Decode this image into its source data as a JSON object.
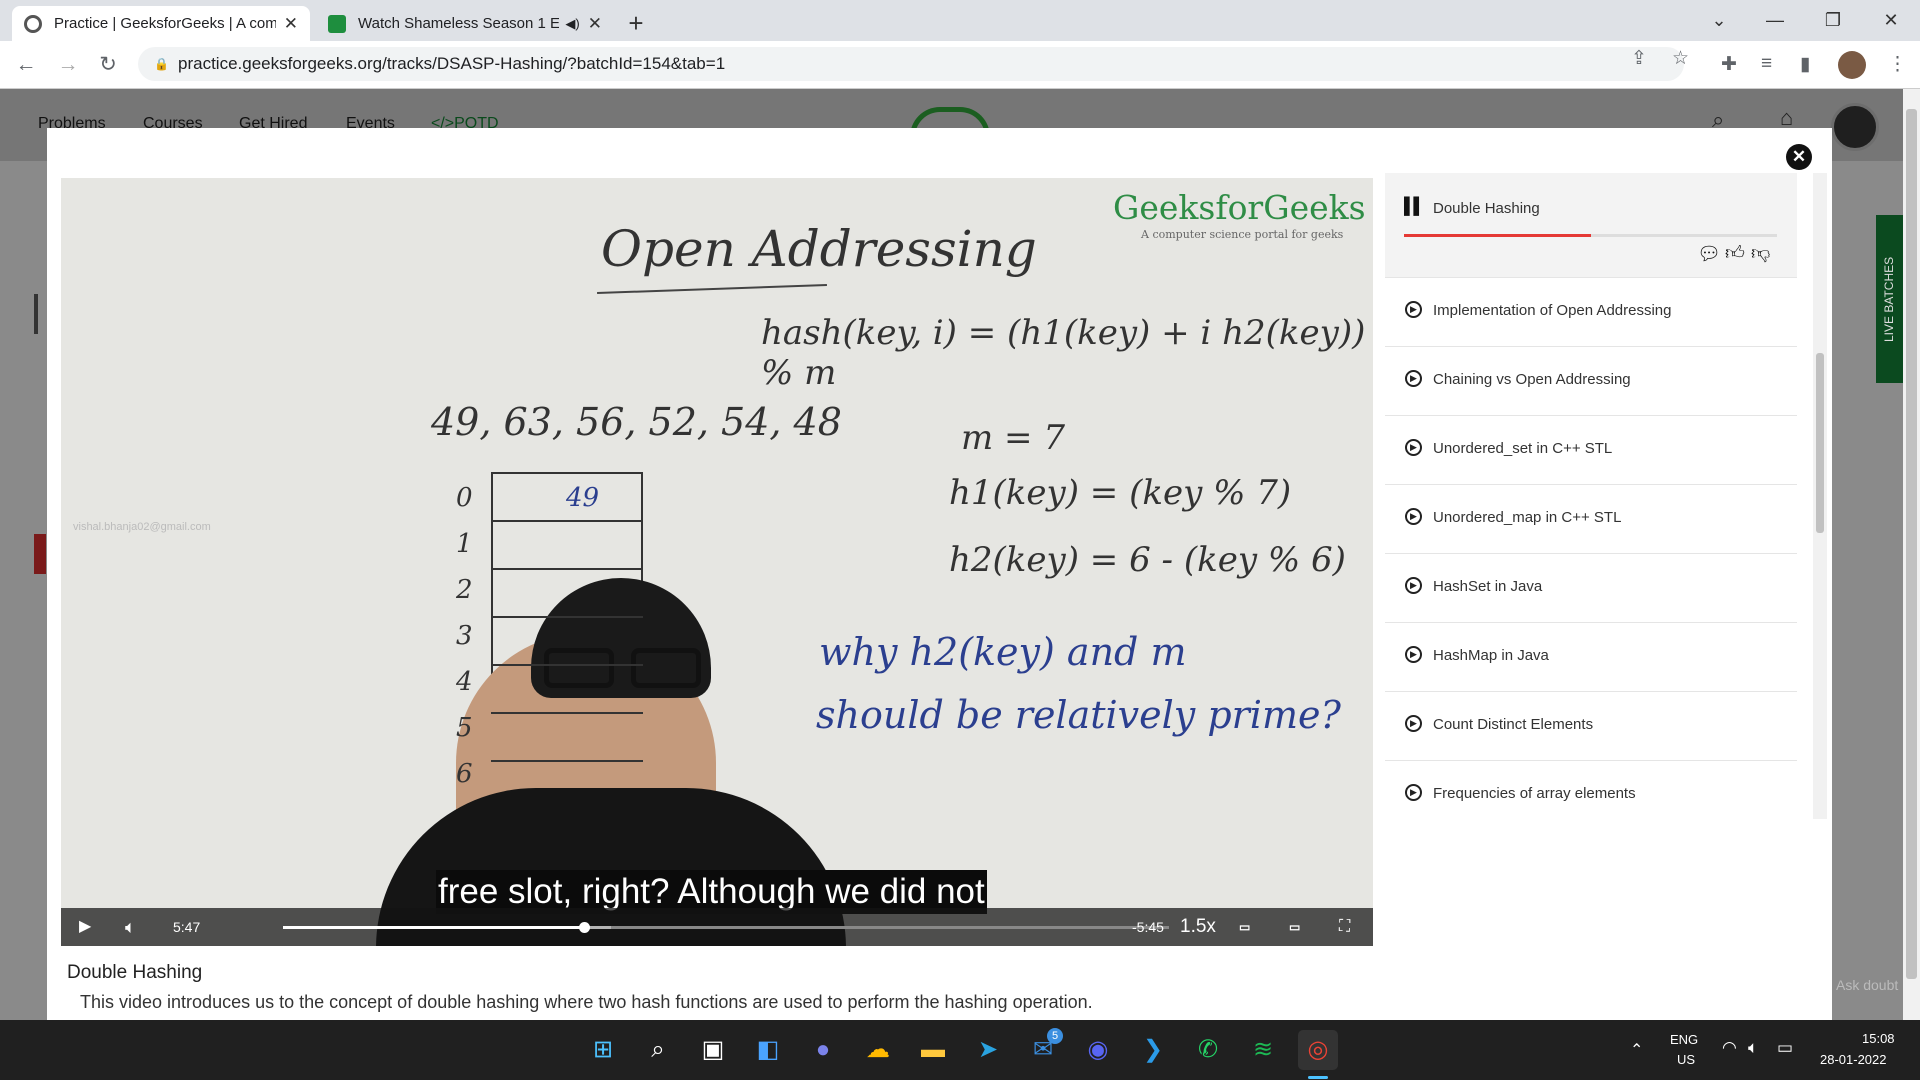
{
  "browser": {
    "tabs": [
      {
        "title": "Practice | GeeksforGeeks | A com",
        "active": true
      },
      {
        "title": "Watch Shameless Season 1 E",
        "active": false,
        "audio": true
      }
    ],
    "url": "practice.geeksforgeeks.org/tracks/DSASP-Hashing/?batchId=154&tab=1"
  },
  "site_nav": {
    "links": [
      "Problems",
      "Courses",
      "Get Hired",
      "Events",
      "</>POTD"
    ],
    "side_tag": "LIVE BATCHES",
    "ask_doubt": "Ask doubt"
  },
  "video": {
    "watermark_brand": "GeeksforGeeks",
    "watermark_tagline": "A computer science portal for geeks",
    "email_overlay": "vishal.bhanja02@gmail.com",
    "board": {
      "heading": "Open Addressing",
      "formula": "hash(key, i) = (h1(key) + i h2(key)) % m",
      "keys": "49, 63, 56, 52, 54, 48",
      "m": "m = 7",
      "h1": "h1(key) = (key % 7)",
      "h2": "h2(key) = 6 - (key % 6)",
      "question_line1": "why h2(key) and m",
      "question_line2": "should be relatively prime?",
      "slots": [
        "0",
        "1",
        "2",
        "3",
        "4",
        "5",
        "6"
      ],
      "slot0_value": "49"
    },
    "caption": "free slot, right? Although we did not",
    "elapsed": "5:47",
    "remaining": "-5:45",
    "speed": "1.5x",
    "progress": 0.34,
    "buffered": 0.37,
    "title": "Double Hashing",
    "description": "This video introduces us to the concept of double hashing where two hash functions are used to perform the hashing operation."
  },
  "playlist": {
    "current": "Double Hashing",
    "current_progress": 0.5,
    "items": [
      "Implementation of Open Addressing",
      "Chaining vs Open Addressing",
      "Unordered_set in C++ STL",
      "Unordered_map in C++ STL",
      "HashSet in Java",
      "HashMap in Java",
      "Count Distinct Elements",
      "Frequencies of array elements"
    ]
  },
  "taskbar": {
    "lang": "ENG",
    "region": "US",
    "time": "15:08",
    "date": "28-01-2022",
    "mail_badge": "5"
  }
}
